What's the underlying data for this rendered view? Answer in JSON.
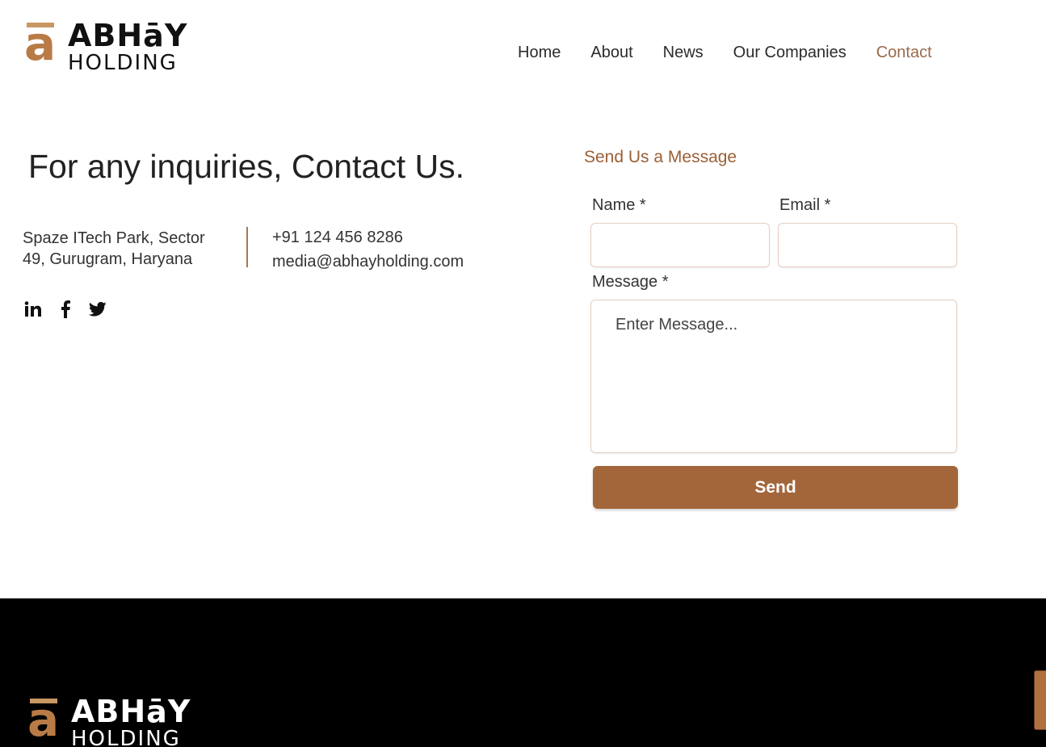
{
  "brand": {
    "letter": "a",
    "name_top": "ABHāY",
    "name_bottom": "HOLDING",
    "accent": "#a3663b"
  },
  "nav": {
    "items": [
      {
        "label": "Home"
      },
      {
        "label": "About"
      },
      {
        "label": "News"
      },
      {
        "label": "Our Companies"
      },
      {
        "label": "Contact",
        "active": true
      }
    ]
  },
  "contact": {
    "headline": "For any inquiries, Contact Us.",
    "address": "Spaze ITech Park, Sector 49, Gurugram, Haryana",
    "phone": "+91 124 456 8286",
    "email": "media@abhayholding.com",
    "socials": [
      "linkedin-icon",
      "facebook-icon",
      "twitter-icon"
    ]
  },
  "form": {
    "title": "Send Us a Message",
    "name_label": "Name *",
    "email_label": "Email *",
    "message_label": "Message *",
    "name_value": "",
    "email_value": "",
    "message_placeholder": "Enter Message...",
    "send_label": "Send"
  }
}
